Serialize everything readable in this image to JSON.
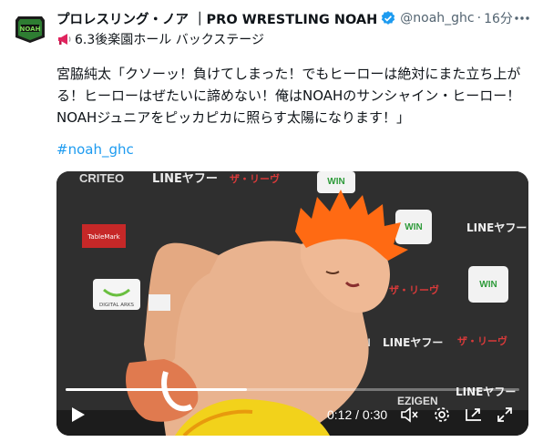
{
  "tweet": {
    "display_name": "プロレスリング・ノア ｜PRO WRESTLING NOAH",
    "handle": "@noah_ghc",
    "separator": "·",
    "time": "16分",
    "subline": "6.3後楽園ホール バックステージ",
    "text_lines": [
      "宮脇純太「クソーッ！負けてしまった！でもヒーローは絶対にまた立ち上が",
      "る！ヒーローはぜたいに諦めない！俺はNOAHのサンシャイン・ヒーロー！",
      "NOAHジュニアをピッカピカに照らす太陽になります！」"
    ],
    "hashtag": "#noah_ghc"
  },
  "video": {
    "current_time": "0:12",
    "duration": "0:30",
    "time_separator": " / ",
    "progress": 0.4,
    "backdrop_logos": [
      "CRITEO",
      "LINEヤフー",
      "ザ・リーヴ",
      "WIN",
      "EZIGEN",
      "TableMark",
      "DIGITAL ARKS"
    ]
  },
  "icons": {
    "verified": "verified-badge-icon",
    "more": "more-icon",
    "megaphone": "megaphone-icon",
    "play": "play-icon",
    "mute": "mute-icon",
    "settings": "settings-icon",
    "pip": "pip-icon",
    "fullscreen": "fullscreen-icon"
  },
  "colors": {
    "verified": "#1d9bf0",
    "hashtag": "#1d9bf0",
    "secondary_text": "#536471",
    "hair": "#ff6a13",
    "brand_green": "#2e7d32"
  }
}
